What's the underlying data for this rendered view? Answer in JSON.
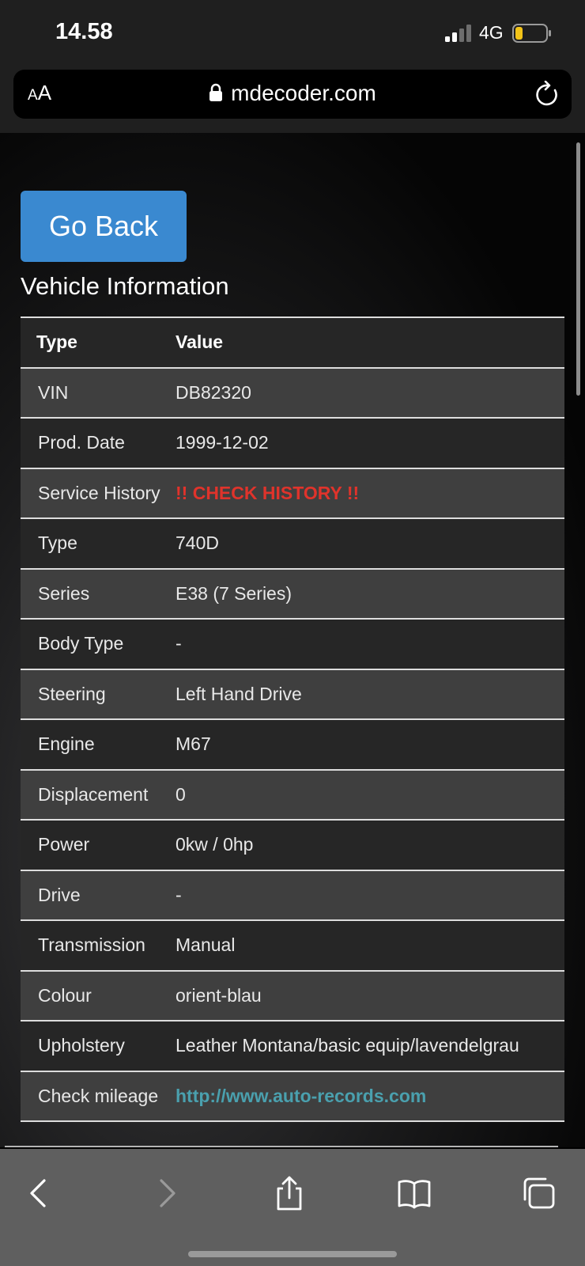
{
  "status_bar": {
    "time": "14.58",
    "network": "4G",
    "icons": [
      "signal-icon",
      "battery-icon"
    ]
  },
  "browser": {
    "text_size_small": "A",
    "text_size_large": "A",
    "url": "mdecoder.com",
    "icons": [
      "lock-icon",
      "reload-icon"
    ]
  },
  "page": {
    "go_back_label": "Go Back",
    "section_title": "Vehicle Information",
    "table": {
      "headers": [
        "Type",
        "Value"
      ],
      "rows": [
        {
          "type": "VIN",
          "value": "DB82320"
        },
        {
          "type": "Prod. Date",
          "value": "1999-12-02"
        },
        {
          "type": "Service History",
          "value": "!! CHECK HISTORY !!"
        },
        {
          "type": "Type",
          "value": "740D"
        },
        {
          "type": "Series",
          "value": "E38 (7 Series)"
        },
        {
          "type": "Body Type",
          "value": "-"
        },
        {
          "type": "Steering",
          "value": "Left Hand Drive"
        },
        {
          "type": "Engine",
          "value": "M67"
        },
        {
          "type": "Displacement",
          "value": "0"
        },
        {
          "type": "Power",
          "value": "0kw / 0hp"
        },
        {
          "type": "Drive",
          "value": "-"
        },
        {
          "type": "Transmission",
          "value": "Manual"
        },
        {
          "type": "Colour",
          "value": "orient-blau"
        },
        {
          "type": "Upholstery",
          "value": "Leather Montana/basic equip/lavendelgrau"
        },
        {
          "type": "Check mileage",
          "value": "http://www.auto-records.com"
        }
      ]
    }
  },
  "toolbar": {
    "icons": [
      "back-icon",
      "forward-icon",
      "share-icon",
      "bookmarks-icon",
      "tabs-icon"
    ]
  },
  "colors": {
    "accent_button": "#3a89d0",
    "warning_text": "#e0332b",
    "link_text": "#4aa0ae"
  }
}
